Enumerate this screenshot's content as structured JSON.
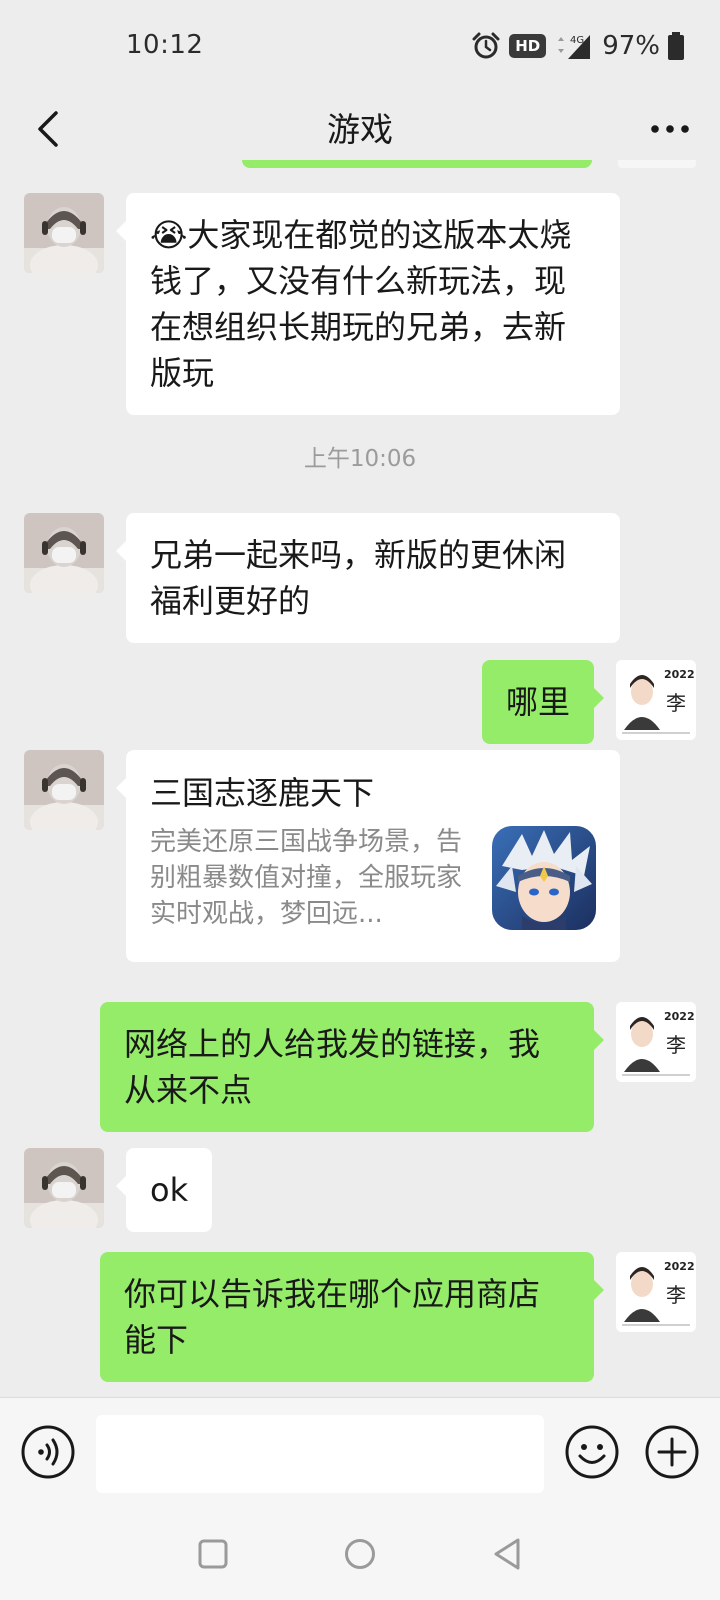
{
  "status_bar": {
    "time": "10:12",
    "hd_badge": "HD",
    "network_label": "4G",
    "battery_percent": "97%",
    "icons": [
      "alarm-icon",
      "signal-icon",
      "battery-icon"
    ]
  },
  "header": {
    "title": "游戏",
    "back_icon": "chevron-left-icon",
    "more_icon": "more-dots-icon"
  },
  "colors": {
    "background": "#ededed",
    "bubble_self": "#95ec69",
    "bubble_other": "#ffffff",
    "timestamp_text": "#9b9b9b"
  },
  "messages": [
    {
      "sender": "other",
      "type": "text",
      "emoji": "😭",
      "text": "大家现在都觉的这版本太烧钱了，又没有什么新玩法，现在想组织长期玩的兄弟，去新版玩"
    },
    {
      "type": "timestamp",
      "text": "上午10:06"
    },
    {
      "sender": "other",
      "type": "text",
      "text": "兄弟一起来吗，新版的更休闲福利更好的"
    },
    {
      "sender": "self",
      "type": "text",
      "text": "哪里"
    },
    {
      "sender": "other",
      "type": "link_card",
      "title": "三国志逐鹿天下",
      "description": "完美还原三国战争场景，告别粗暴数值对撞，全服玩家实时观战，梦回远...",
      "thumbnail_icon": "game-character-thumbnail"
    },
    {
      "sender": "self",
      "type": "text",
      "text": "网络上的人给我发的链接，我从来不点"
    },
    {
      "sender": "other",
      "type": "text",
      "text": "ok"
    },
    {
      "sender": "self",
      "type": "text",
      "text": "你可以告诉我在哪个应用商店能下"
    }
  ],
  "self_avatar": {
    "year": "2022",
    "name_char": "李"
  },
  "input_bar": {
    "value": "",
    "placeholder": "",
    "voice_icon": "voice-icon",
    "emoji_icon": "emoji-icon",
    "plus_icon": "plus-icon"
  },
  "system_nav": {
    "buttons": [
      "recent-apps-icon",
      "home-icon",
      "back-triangle-icon"
    ]
  }
}
